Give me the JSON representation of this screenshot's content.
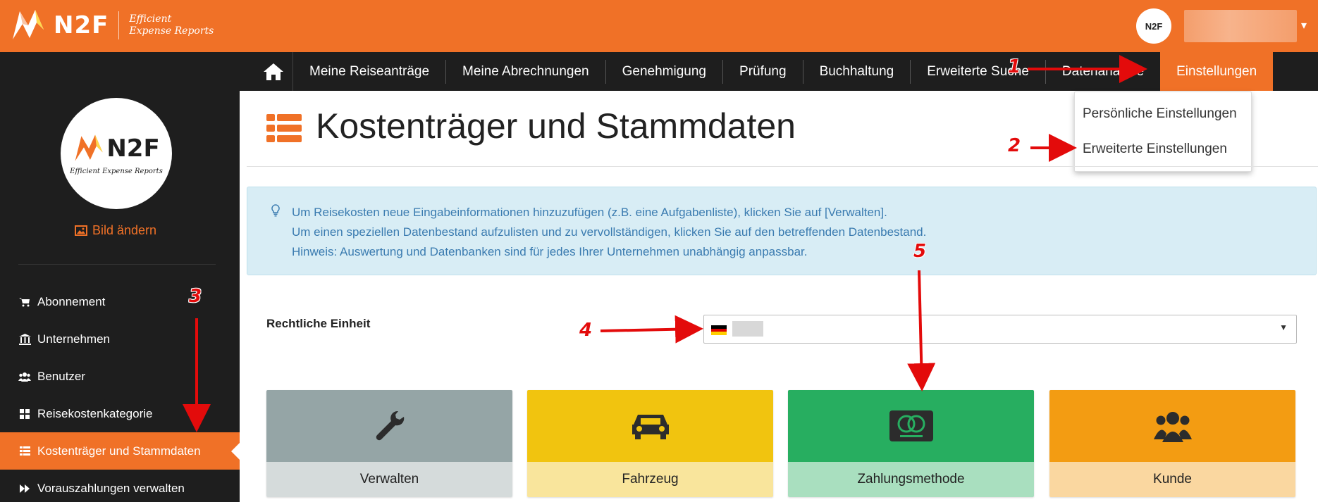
{
  "brand": {
    "name": "N2F",
    "tagline_line1": "Efficient",
    "tagline_line2": "Expense Reports",
    "avatar_tagline": "Efficient Expense Reports"
  },
  "nav": {
    "items": [
      {
        "label": "Meine Reiseanträge"
      },
      {
        "label": "Meine Abrechnungen"
      },
      {
        "label": "Genehmigung"
      },
      {
        "label": "Prüfung"
      },
      {
        "label": "Buchhaltung"
      },
      {
        "label": "Erweiterte Suche"
      },
      {
        "label": "Datenanalyse"
      },
      {
        "label": "Einstellungen"
      }
    ]
  },
  "dropdown": {
    "items": [
      {
        "label": "Persönliche Einstellungen"
      },
      {
        "label": "Erweiterte Einstellungen"
      }
    ]
  },
  "sidebar": {
    "change_image": "Bild ändern",
    "items": [
      {
        "label": "Abonnement",
        "icon": "cart-icon"
      },
      {
        "label": "Unternehmen",
        "icon": "institution-icon"
      },
      {
        "label": "Benutzer",
        "icon": "users-icon"
      },
      {
        "label": "Reisekostenkategorie",
        "icon": "grid-icon"
      },
      {
        "label": "Kostenträger und Stammdaten",
        "icon": "list-icon"
      },
      {
        "label": "Vorauszahlungen verwalten",
        "icon": "forward-icon"
      }
    ]
  },
  "page": {
    "title": "Kostenträger und Stammdaten",
    "info_lines": [
      "Um Reisekosten neue Eingabeinformationen hinzuzufügen (z.B. eine Aufgabenliste), klicken Sie auf [Verwalten].",
      "Um einen speziellen Datenbestand aufzulisten und zu vervollständigen, klicken Sie auf den betreffenden Datenbestand.",
      "Hinweis: Auswertung und Datenbanken sind für jedes Ihrer Unternehmen unabhängig anpassbar."
    ],
    "legal_entity_label": "Rechtliche Einheit"
  },
  "tiles": [
    {
      "label": "Verwalten",
      "icon": "wrench-icon",
      "top_color": "#95a5a6",
      "bottom_color": "#d5dbdb"
    },
    {
      "label": "Fahrzeug",
      "icon": "car-icon",
      "top_color": "#f1c40f",
      "bottom_color": "#f9e59c"
    },
    {
      "label": "Zahlungsmethode",
      "icon": "credit-card-icon",
      "top_color": "#27ae60",
      "bottom_color": "#a9dfbf"
    },
    {
      "label": "Kunde",
      "icon": "users-icon",
      "top_color": "#f39c12",
      "bottom_color": "#fad7a0"
    }
  ],
  "annotations": [
    "1",
    "2",
    "3",
    "4",
    "5"
  ],
  "colors": {
    "accent": "#f07127",
    "dark": "#1e1e1e",
    "info_bg": "#d8edf5",
    "info_text": "#3a7bb0",
    "arrow": "#e30b0b"
  }
}
